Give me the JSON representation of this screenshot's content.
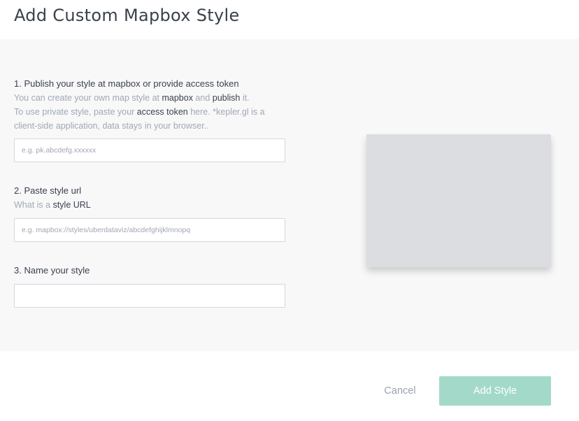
{
  "modal": {
    "title": "Add Custom Mapbox Style"
  },
  "steps": {
    "publish": {
      "title": "1. Publish your style at mapbox or provide access token",
      "desc_line1_a": "You can create your own map style at ",
      "desc_line1_link1": "mapbox",
      "desc_line1_b": " and ",
      "desc_line1_link2": "publish",
      "desc_line1_c": " it.",
      "desc_line2_a": "To use private style, paste your ",
      "desc_line2_link": "access token",
      "desc_line2_b": " here. *kepler.gl is a",
      "desc_line3": "client-side application, data stays in your browser..",
      "input_placeholder": "e.g. pk.abcdefg.xxxxxx",
      "input_value": ""
    },
    "style_url": {
      "title": "2. Paste style url",
      "desc_a": "What is a ",
      "desc_link": "style URL",
      "input_placeholder": "e.g. mapbox://styles/uberdataviz/abcdefghijklmnopq",
      "input_value": ""
    },
    "name": {
      "title": "3. Name your style",
      "input_placeholder": "",
      "input_value": ""
    }
  },
  "footer": {
    "cancel_label": "Cancel",
    "add_label": "Add Style"
  },
  "colors": {
    "primary_disabled": "#a3d9c9",
    "body_bg": "#f8f8f9",
    "preview_bg": "#dcdde0"
  }
}
